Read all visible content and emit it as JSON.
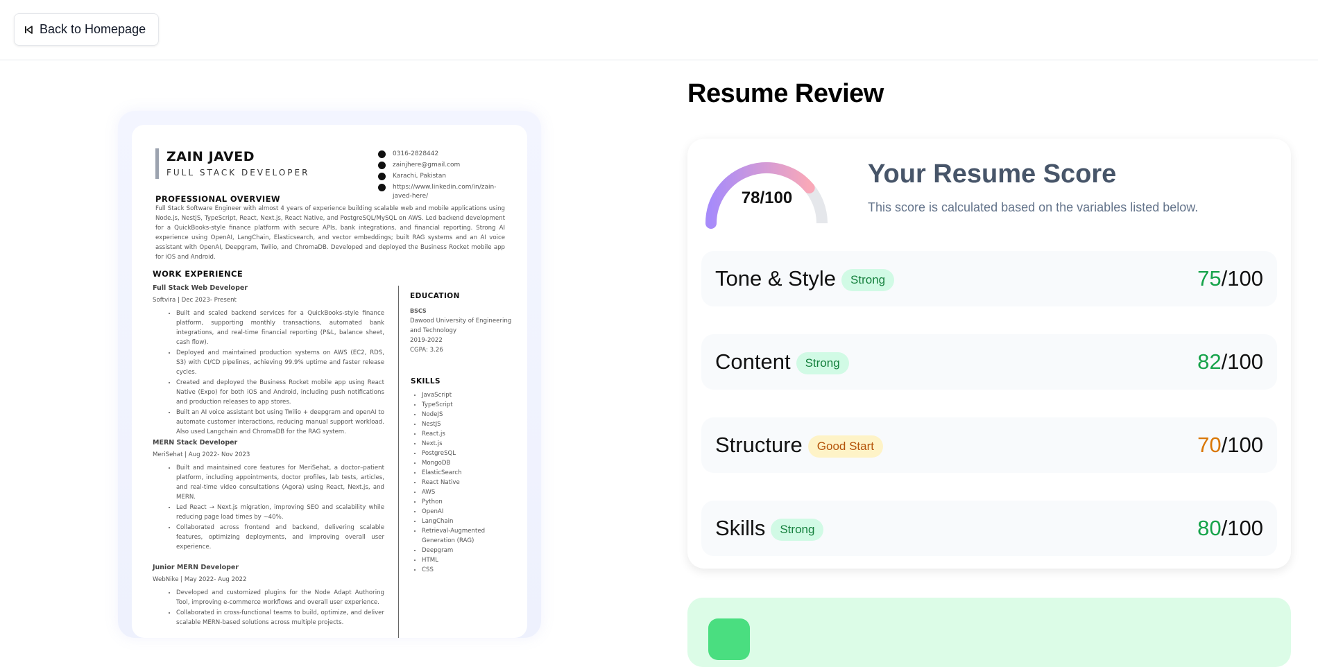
{
  "nav": {
    "back_label": "Back to Homepage"
  },
  "resume": {
    "name": "ZAIN JAVED",
    "role": "FULL STACK DEVELOPER",
    "contacts": [
      "0316-2828442",
      "zainjhere@gmail.com",
      "Karachi, Pakistan",
      "https://www.linkedin.com/in/zain-javed-here/"
    ],
    "overview_heading": "PROFESSIONAL OVERVIEW",
    "overview": "Full Stack Software Engineer with almost 4 years of experience building scalable web and mobile applications using Node.js, NestJS, TypeScript, React, Next.js, React Native, and PostgreSQL/MySQL on AWS. Led backend development for a QuickBooks-style finance platform with secure APIs, bank integrations, and financial reporting. Strong AI experience using OpenAI, LangChain, Elasticsearch, and vector embeddings; built RAG systems and an AI voice assistant with OpenAI, Deepgram, Twilio, and ChromaDB. Developed and deployed the Business Rocket mobile app for iOS and Android.",
    "work_heading": "WORK EXPERIENCE",
    "jobs": [
      {
        "title": "Full Stack Web Developer",
        "company": "Softvira | Dec 2023- Present",
        "bullets": [
          "Built and scaled backend services for a QuickBooks-style finance platform, supporting monthly transactions, automated bank integrations, and real-time financial reporting (P&L, balance sheet, cash flow).",
          "Deployed and maintained production systems on AWS (EC2, RDS, S3) with CI/CD pipelines, achieving 99.9% uptime and faster release cycles.",
          "Created and deployed the Business Rocket mobile app using React Native (Expo) for both iOS and Android, including push notifications and production releases to app stores.",
          "Built an AI voice assistant bot using Twilio + deepgram and openAI to automate customer interactions, reducing manual support workload. Also used Langchain and ChromaDB for the RAG system."
        ]
      },
      {
        "title": "MERN Stack Developer",
        "company": "MeriSehat | Aug 2022- Nov 2023",
        "bullets": [
          "Built and maintained core features for MeriSehat, a doctor–patient platform, including appointments, doctor profiles, lab tests, articles, and real-time video consultations (Agora) using React, Next.js, and MERN.",
          "Led React → Next.js migration, improving SEO and scalability while reducing page load times by ~40%.",
          "Collaborated across frontend and backend, delivering scalable features, optimizing deployments, and improving overall user experience."
        ]
      },
      {
        "title": "Junior MERN Developer",
        "company": "WebNike | May 2022- Aug 2022",
        "bullets": [
          "Developed and customized plugins for the Node Adapt Authoring Tool, improving e-commerce workflows and overall user experience.",
          "Collaborated in cross-functional teams to build, optimize, and deliver scalable MERN-based solutions across multiple projects."
        ]
      }
    ],
    "education_heading": "EDUCATION",
    "education": {
      "degree": "BSCS",
      "school": "Dawood University of Engineering and Technology",
      "years": "2019-2022",
      "cgpa": "CGPA: 3.26"
    },
    "skills_heading": "SKILLS",
    "skills": [
      "JavaScript",
      "TypeScript",
      "NodeJS",
      "NestJS",
      "React.js",
      "Next.js",
      "PostgreSQL",
      "MongoDB",
      "ElasticSearch",
      "React Native",
      "AWS",
      "Python",
      "OpenAI",
      "LangChain",
      "Retrieval-Augmented Generation (RAG)",
      "Deepgram",
      "HTML",
      "CSS"
    ]
  },
  "review": {
    "title": "Resume Review",
    "score_label": "78/100",
    "score_value": 78,
    "score_title": "Your Resume Score",
    "score_desc": "This score is calculated based on the variables listed below.",
    "categories": [
      {
        "name": "Tone & Style",
        "badge": "Strong",
        "score": "75",
        "max": "/100",
        "tone": "green"
      },
      {
        "name": "Content",
        "badge": "Strong",
        "score": "82",
        "max": "/100",
        "tone": "green"
      },
      {
        "name": "Structure",
        "badge": "Good Start",
        "score": "70",
        "max": "/100",
        "tone": "orange"
      },
      {
        "name": "Skills",
        "badge": "Strong",
        "score": "80",
        "max": "/100",
        "tone": "green"
      }
    ]
  },
  "colors": {
    "gauge_start": "#a78bfa",
    "gauge_end": "#f9a8b8",
    "gauge_track": "#e5e7eb",
    "ats_bg": "#dcfce7"
  }
}
